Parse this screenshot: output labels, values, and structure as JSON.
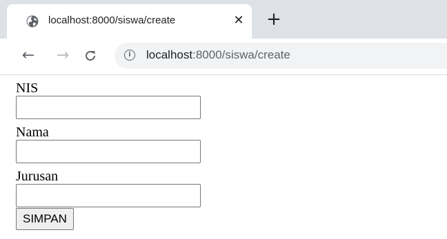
{
  "browser": {
    "tab": {
      "favicon": "globe-icon",
      "title": "localhost:8000/siswa/create",
      "close_symbol": "✕"
    },
    "new_tab_symbol": "+",
    "toolbar": {
      "back_symbol": "←",
      "forward_symbol": "→",
      "reload_symbol": "C",
      "info_symbol": "i",
      "url_host": "localhost",
      "url_path": ":8000/siswa/create"
    }
  },
  "form": {
    "fields": [
      {
        "label": "NIS",
        "value": ""
      },
      {
        "label": "Nama",
        "value": ""
      },
      {
        "label": "Jurusan",
        "value": ""
      }
    ],
    "submit_label": "SIMPAN"
  }
}
